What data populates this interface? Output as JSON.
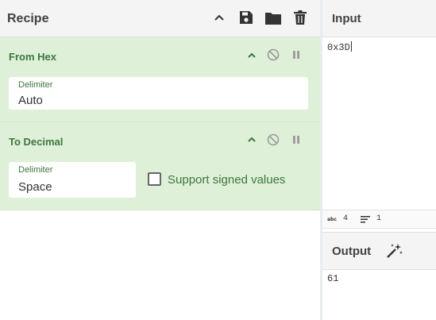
{
  "recipe": {
    "title": "Recipe",
    "header_icons": [
      "chevron-up-icon",
      "save-icon",
      "folder-icon",
      "trash-icon"
    ]
  },
  "operations": [
    {
      "name": "From Hex",
      "delimiter_label": "Delimiter",
      "delimiter_value": "Auto"
    },
    {
      "name": "To Decimal",
      "delimiter_label": "Delimiter",
      "delimiter_value": "Space",
      "checkbox_label": "Support signed values",
      "checkbox_checked": false
    }
  ],
  "input": {
    "title": "Input",
    "value": "0x3D",
    "stats": {
      "length_icon": "abc-icon",
      "length": "4",
      "lines_icon": "lines-icon",
      "lines": "1"
    }
  },
  "output": {
    "title": "Output",
    "value": "61",
    "icon": "magic-wand-icon"
  },
  "colors": {
    "op_bg": "#dff0d8",
    "op_text": "#3c763d",
    "header_bg": "#f4f4f4"
  }
}
